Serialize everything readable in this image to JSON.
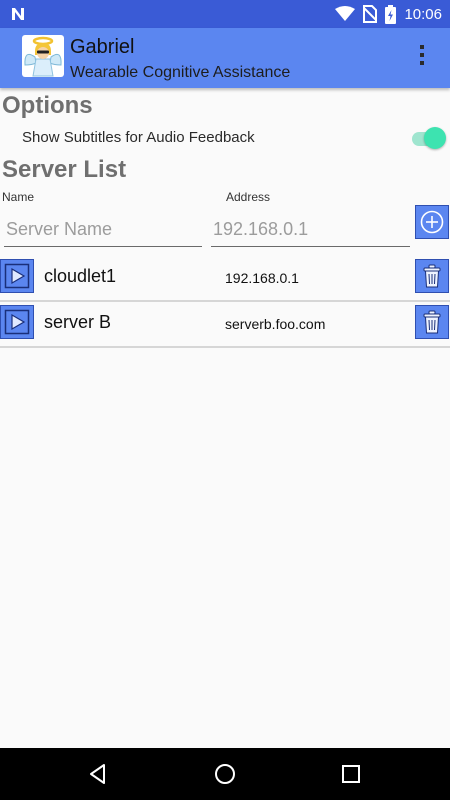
{
  "status_bar": {
    "time": "10:06",
    "icons": [
      "n-notification-icon",
      "wifi-icon",
      "no-sim-icon",
      "battery-charging-icon"
    ]
  },
  "app_bar": {
    "title": "Gabriel",
    "subtitle": "Wearable Cognitive Assistance",
    "icon": "angel-app-icon",
    "menu_icon": "more-vert-icon"
  },
  "options": {
    "heading": "Options",
    "show_subtitles": {
      "label": "Show Subtitles for Audio Feedback",
      "enabled": true
    }
  },
  "server_list": {
    "heading": "Server List",
    "name_label": "Name",
    "address_label": "Address",
    "name_input": {
      "value": "",
      "placeholder": "Server Name"
    },
    "address_input": {
      "value": "",
      "placeholder": "192.168.0.1"
    },
    "add_icon": "add-circle-icon",
    "servers": [
      {
        "name": "cloudlet1",
        "address": "192.168.0.1",
        "connect_icon": "play-icon",
        "delete_icon": "trash-icon"
      },
      {
        "name": "server B",
        "address": "serverb.foo.com",
        "connect_icon": "play-icon",
        "delete_icon": "trash-icon"
      }
    ]
  },
  "nav_bar": {
    "buttons": [
      "back-icon",
      "home-icon",
      "recents-icon"
    ]
  },
  "colors": {
    "status_bar": "#3a5bd6",
    "app_bar": "#5b86f0",
    "switch_on": "#3de3b0",
    "background": "#fafafa",
    "section_heading": "#6f6f6f"
  }
}
